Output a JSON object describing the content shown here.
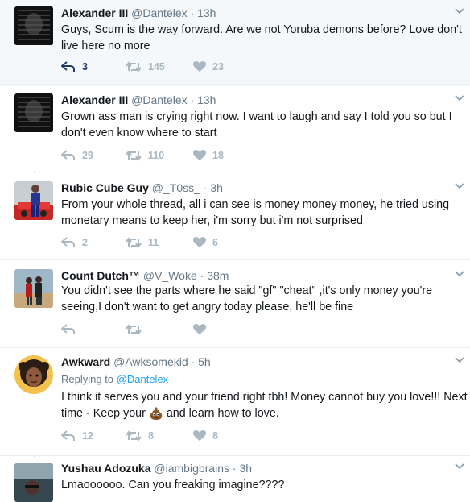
{
  "tweets": [
    {
      "name": "Alexander III",
      "handle": "@Dantelex",
      "time": "13h",
      "text": "Guys, Scum is the way forward. Are we not Yoruba demons before? Love don't live here no more",
      "replies": "3",
      "retweets": "145",
      "likes": "23"
    },
    {
      "name": "Alexander III",
      "handle": "@Dantelex",
      "time": "13h",
      "text": "Grown ass man is crying right now. I want to laugh and say I told you so but I don't even know where to start",
      "replies": "29",
      "retweets": "110",
      "likes": "18"
    },
    {
      "name": "Rubic Cube Guy",
      "handle": "@_T0ss_",
      "time": "3h",
      "text": "From your whole thread, all i can see is money money money, he tried using monetary means to keep her, i'm sorry but i'm not surprised",
      "replies": "2",
      "retweets": "11",
      "likes": "6"
    },
    {
      "name": "Count Dutch™",
      "handle": "@V_Woke",
      "time": "38m",
      "text": "You didn't see the parts where he said \"gf\" \"cheat\" ,it's only money you're seeing,I don't want to get angry today please, he'll be fine",
      "replies": "",
      "retweets": "",
      "likes": ""
    },
    {
      "name": "Awkward",
      "handle": "@Awksomekid",
      "time": "5h",
      "replying_label": "Replying to",
      "replying_to": "@Dantelex",
      "text_before": "I think it serves you and your friend right tbh! Money cannot buy you love!!! Next time - Keep your",
      "emoji": "pile-of-poo-emoji",
      "text_after": "and learn how to love.",
      "replies": "12",
      "retweets": "8",
      "likes": "8"
    },
    {
      "name": "Yushau Adozuka",
      "handle": "@iambigbrains",
      "time": "3h",
      "text": "Lmaoooooo. Can you freaking imagine????"
    }
  ],
  "separator": "·",
  "colors": {
    "name": "#14171a",
    "meta": "#657786",
    "action": "#aab8c2",
    "reply_active": "#1b3a66",
    "link": "#1da1f2",
    "thread_line": "#ccd6dd",
    "highlight_bg": "#f5f8fa"
  }
}
